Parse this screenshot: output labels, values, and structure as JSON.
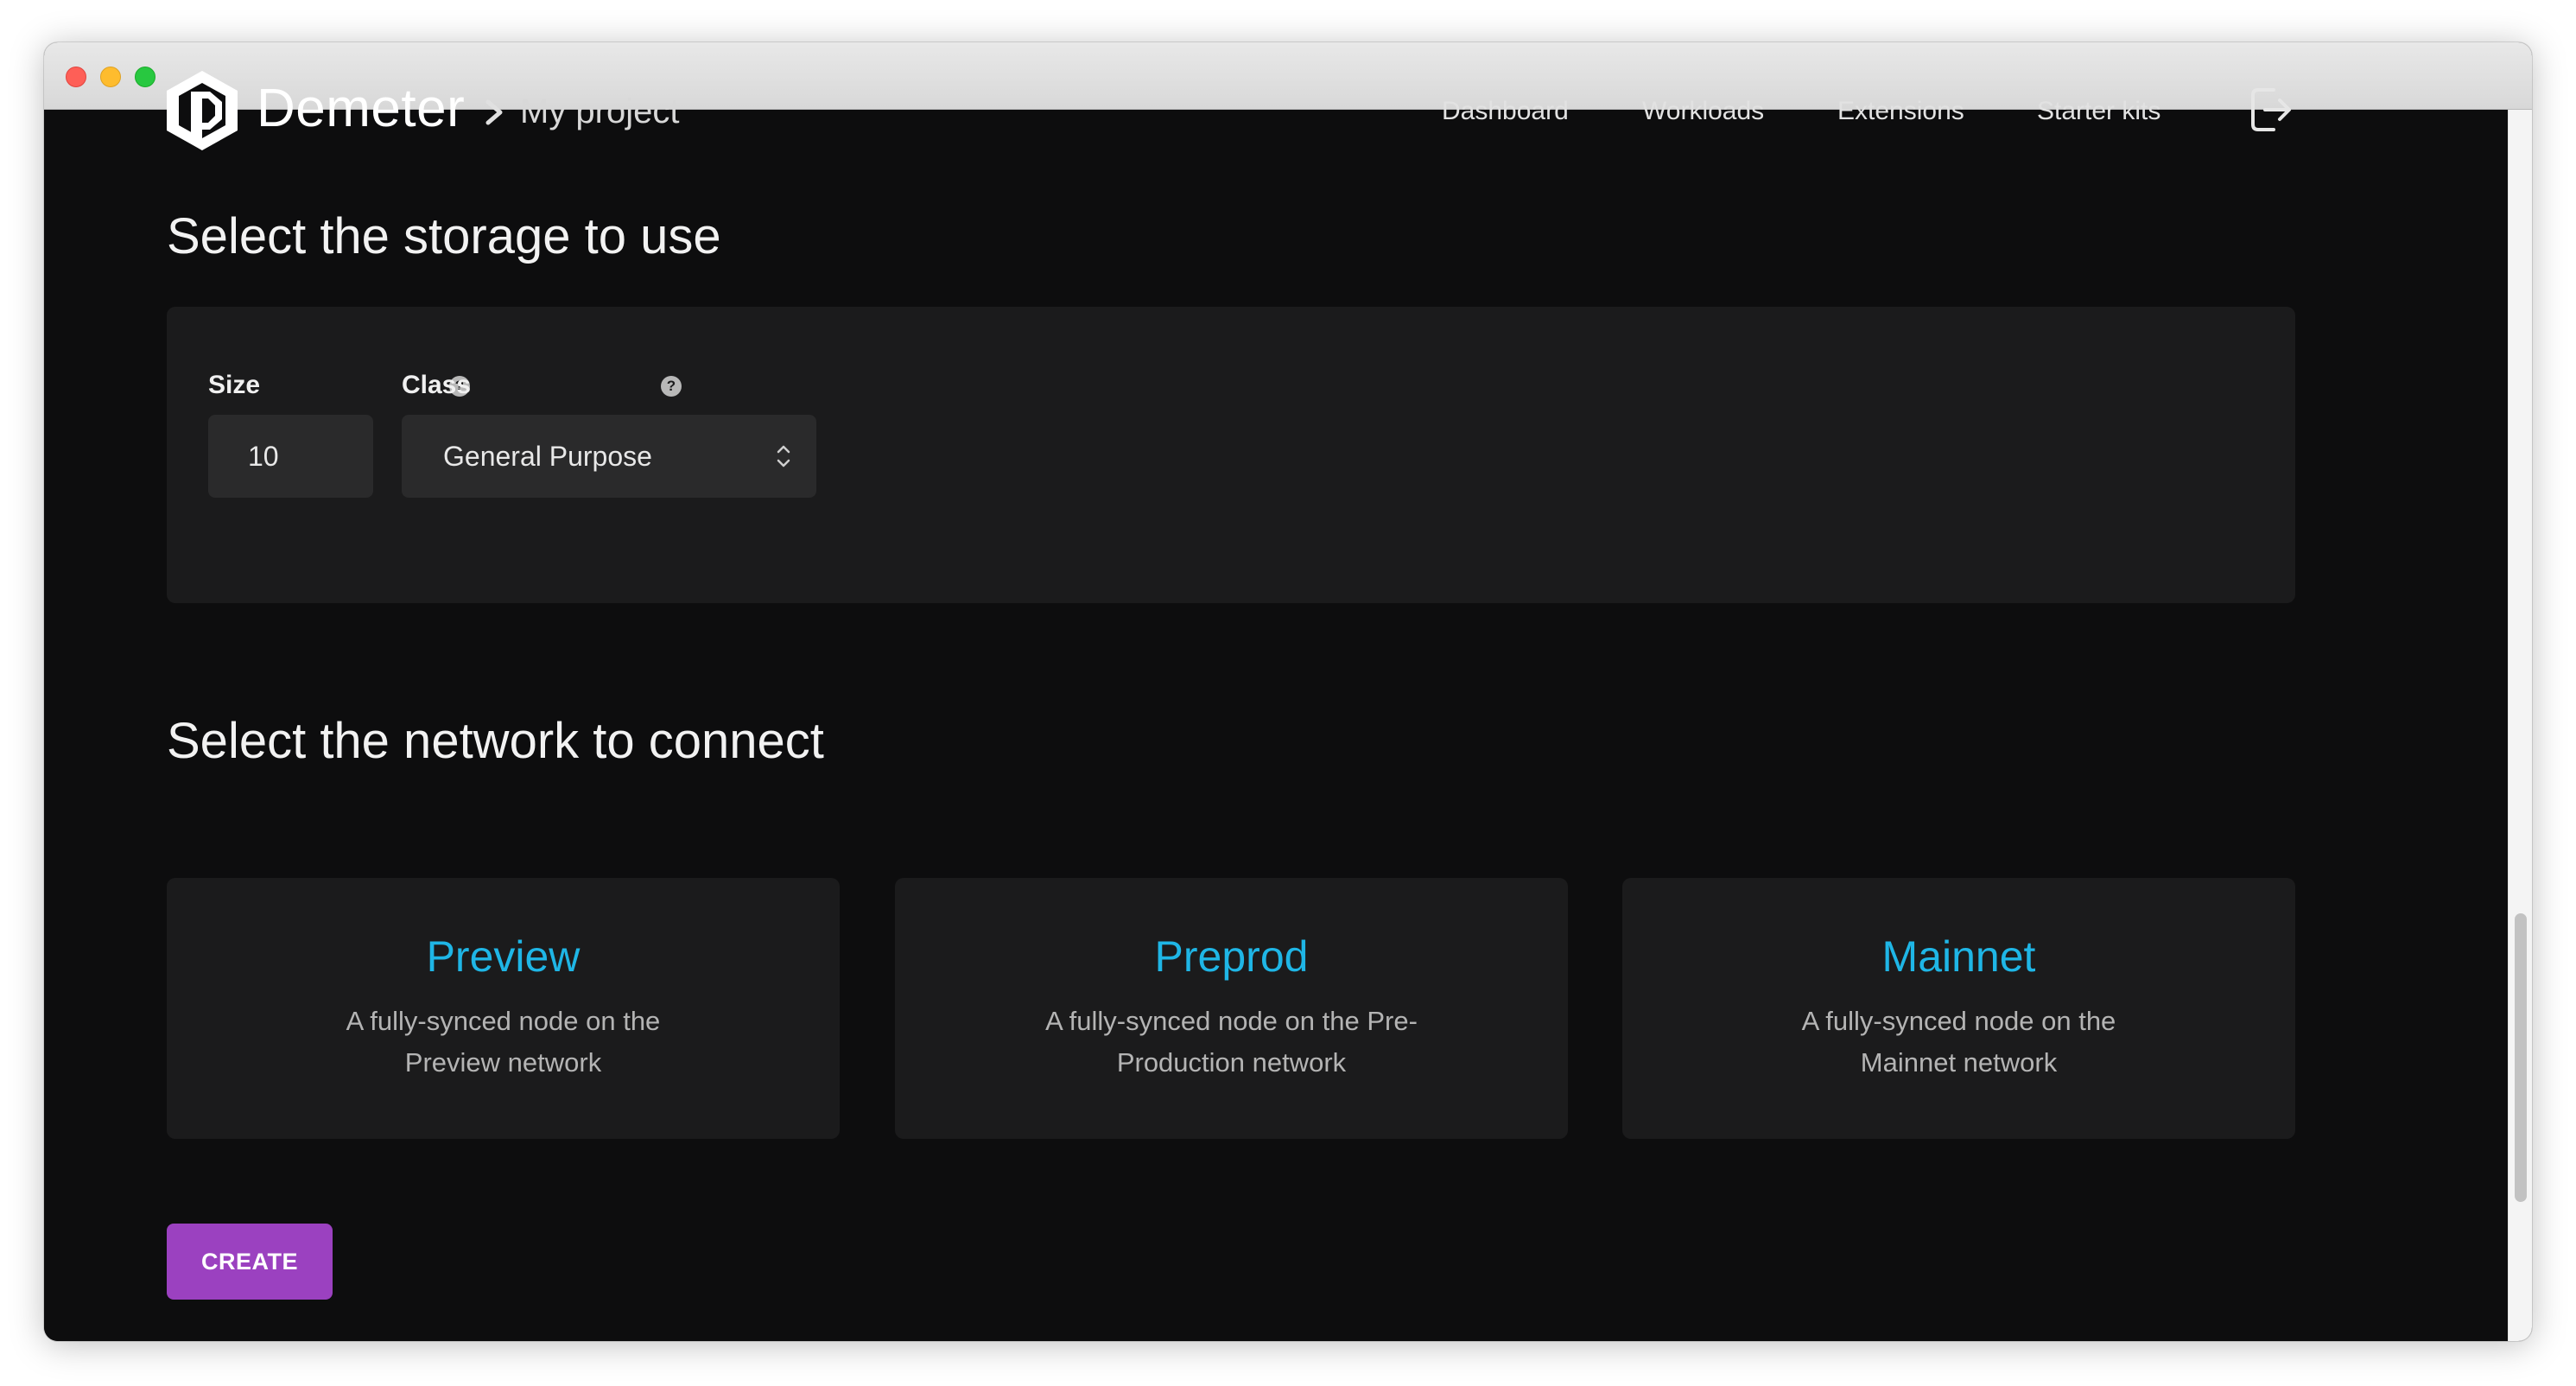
{
  "header": {
    "brand": "Demeter",
    "breadcrumb_project": "My project",
    "nav": [
      {
        "label": "Dashboard"
      },
      {
        "label": "Workloads"
      },
      {
        "label": "Extensions"
      },
      {
        "label": "Starter kits"
      }
    ],
    "logout_icon": "logout-icon"
  },
  "storage": {
    "title": "Select the storage to use",
    "size_label": "Size",
    "size_value": "10",
    "class_label": "Class",
    "class_value": "General Purpose",
    "help_glyph": "?"
  },
  "network": {
    "title": "Select the network to connect",
    "options": [
      {
        "name": "Preview",
        "description": "A fully-synced node on the Preview network"
      },
      {
        "name": "Preprod",
        "description": "A fully-synced node on the Pre-Production network"
      },
      {
        "name": "Mainnet",
        "description": "A fully-synced node on the Mainnet network"
      }
    ]
  },
  "actions": {
    "create_label": "CREATE"
  },
  "colors": {
    "accent_link": "#1fb6e6",
    "primary_button": "#9b41c0",
    "background": "#0d0d0e",
    "panel": "#1b1b1c"
  }
}
